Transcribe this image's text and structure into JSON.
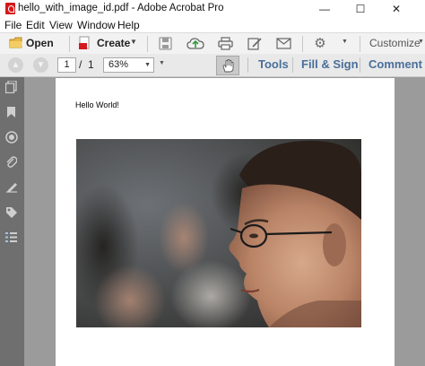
{
  "window": {
    "title": "hello_with_image_id.pdf - Adobe Acrobat Pro",
    "minimize_glyph": "—",
    "maximize_glyph": "☐",
    "close_glyph": "✕"
  },
  "menu": [
    "File",
    "Edit",
    "View",
    "Window",
    "Help"
  ],
  "toolbar": {
    "open_label": "Open",
    "create_label": "Create",
    "customize_label": "Customize",
    "icons": [
      "save-icon",
      "upload-cloud-icon",
      "print-icon",
      "edit-sign-icon",
      "email-icon",
      "settings-gear-icon"
    ]
  },
  "nav": {
    "page_current": "1",
    "page_separator": "/",
    "page_total": "1",
    "zoom": "63%",
    "tools_label": "Tools",
    "fillsign_label": "Fill & Sign",
    "comment_label": "Comment"
  },
  "document": {
    "text": "Hello World!",
    "image": "photo-portrait-man-glasses"
  },
  "colors": {
    "accent_link": "#4a6f9a",
    "pdf_red": "#d4191c",
    "rail_bg": "#6f6f6f",
    "viewer_bg": "#9b9b9b"
  }
}
